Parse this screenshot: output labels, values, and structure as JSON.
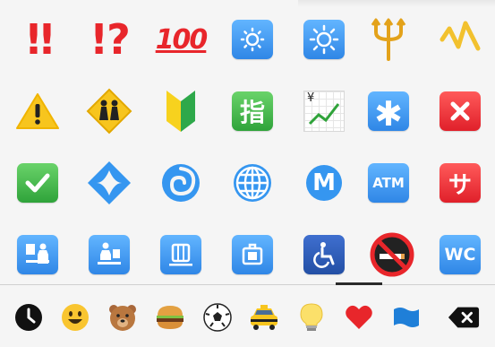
{
  "grid": {
    "row1": {
      "double_exclamation": "!!",
      "exclamation_question": "!?",
      "hundred": "100"
    },
    "row2": {
      "chart_yen": "¥"
    },
    "row3": {
      "m_circle": "M",
      "atm": "ATM",
      "sa": "サ"
    },
    "row4": {
      "wc": "WC"
    }
  },
  "categories": [
    "recent-icon",
    "smileys-icon",
    "animals-icon",
    "food-icon",
    "activity-icon",
    "travel-icon",
    "objects-icon",
    "symbols-icon",
    "flags-icon",
    "delete-icon"
  ],
  "active_category": "symbols-icon",
  "colors": {
    "bg": "#f5f5f5",
    "red": "#e8262b",
    "blue": "#2f86e6",
    "green": "#2fa33a"
  }
}
